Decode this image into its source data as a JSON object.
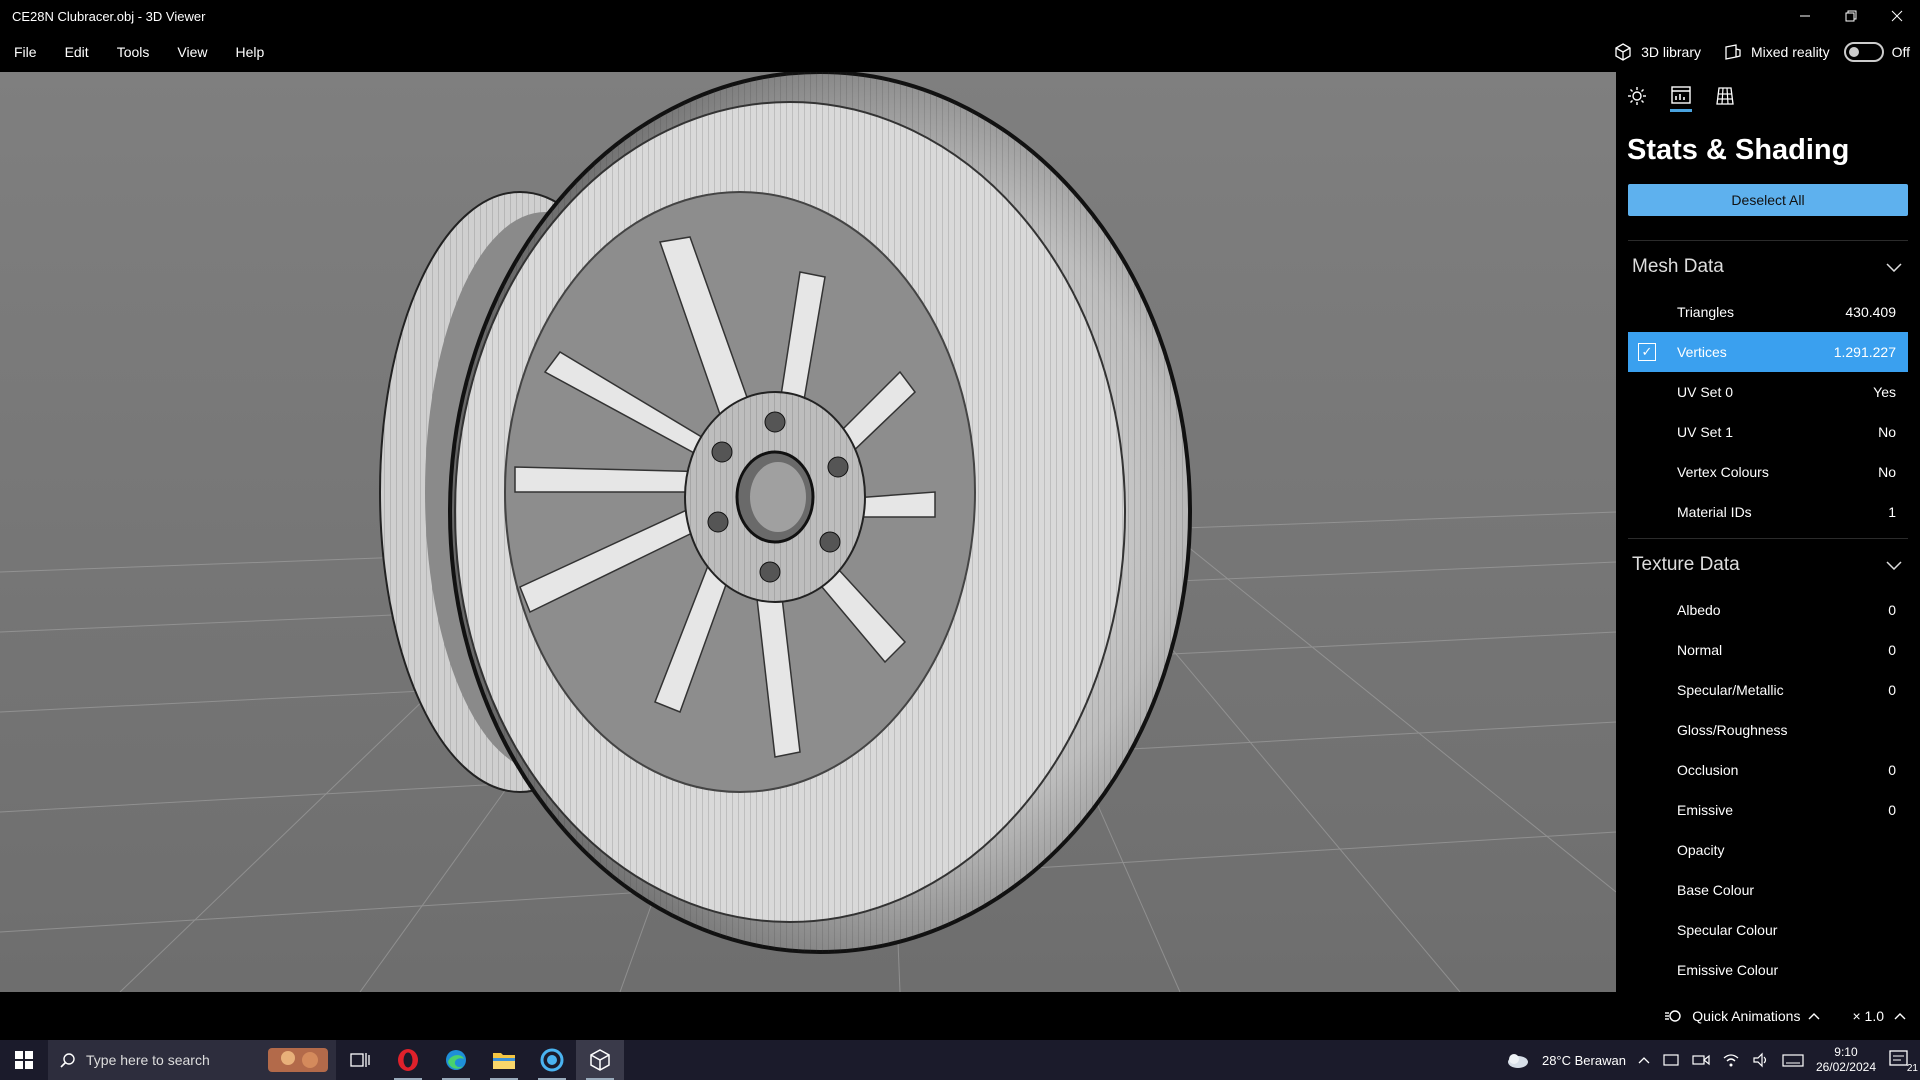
{
  "window": {
    "title": "CE28N Clubracer.obj - 3D Viewer",
    "controls": [
      "minimize",
      "restore",
      "close"
    ]
  },
  "menu": {
    "items": [
      "File",
      "Edit",
      "Tools",
      "View",
      "Help"
    ],
    "library_label": "3D library",
    "mixed_reality_label": "Mixed reality",
    "toggle_state": "Off"
  },
  "panel": {
    "title": "Stats & Shading",
    "deselect_label": "Deselect All",
    "mesh": {
      "heading": "Mesh Data",
      "rows": [
        {
          "label": "Triangles",
          "value": "430.409"
        },
        {
          "label": "Vertices",
          "value": "1.291.227"
        },
        {
          "label": "UV Set 0",
          "value": "Yes"
        },
        {
          "label": "UV Set 1",
          "value": "No"
        },
        {
          "label": "Vertex Colours",
          "value": "No"
        },
        {
          "label": "Material IDs",
          "value": "1"
        }
      ]
    },
    "texture": {
      "heading": "Texture Data",
      "rows": [
        {
          "label": "Albedo",
          "value": "0"
        },
        {
          "label": "Normal",
          "value": "0"
        },
        {
          "label": "Specular/Metallic",
          "value": "0"
        },
        {
          "label": "Gloss/Roughness",
          "value": ""
        },
        {
          "label": "Occlusion",
          "value": "0"
        },
        {
          "label": "Emissive",
          "value": "0"
        },
        {
          "label": "Opacity",
          "value": ""
        },
        {
          "label": "Base Colour",
          "value": ""
        },
        {
          "label": "Specular Colour",
          "value": ""
        },
        {
          "label": "Emissive Colour",
          "value": ""
        }
      ]
    }
  },
  "status": {
    "quick_animations": "Quick Animations",
    "zoom": "× 1.0"
  },
  "taskbar": {
    "search_placeholder": "Type here to search",
    "weather": "28°C  Berawan",
    "time": "9:10",
    "date": "26/02/2024",
    "notifications": "21"
  },
  "colors": {
    "accent": "#3aa0ef",
    "button": "#5eb1ee",
    "viewport_bg": "#7a7a7a"
  }
}
